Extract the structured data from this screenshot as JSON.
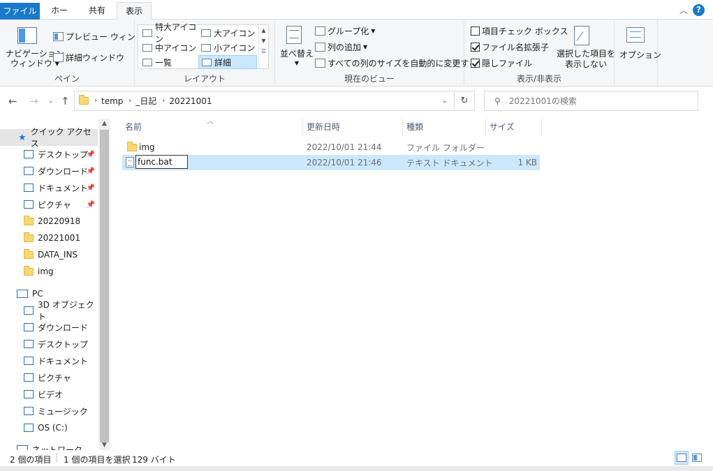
{
  "tabs": {
    "file": "ファイル",
    "home": "ホーム",
    "share": "共有",
    "view": "表示"
  },
  "ribbon": {
    "pane": {
      "nav_pane": "ナビゲーション",
      "nav_pane_2": "ウィンドウ",
      "preview": "プレビュー ウィンドウ",
      "details_pane": "詳細ウィンドウ",
      "label": "ペイン"
    },
    "layout": {
      "items": [
        "特大アイコン",
        "大アイコン",
        "中アイコン",
        "小アイコン",
        "一覧",
        "詳細"
      ],
      "selected": "詳細",
      "label": "レイアウト"
    },
    "current_view": {
      "sort": "並べ替え",
      "group": "グループ化",
      "add_column": "列の追加",
      "autosize": "すべての列のサイズを自動的に変更する",
      "label": "現在のビュー"
    },
    "show_hide": {
      "item_checkbox": "項目チェック ボックス",
      "file_ext": "ファイル名拡張子",
      "hidden": "隠しファイル",
      "hide_selected_1": "選択した項目を",
      "hide_selected_2": "表示しない",
      "label": "表示/非表示",
      "item_checkbox_on": false,
      "file_ext_on": true,
      "hidden_on": true
    },
    "options": "オプション"
  },
  "address": {
    "crumbs": [
      "temp",
      "_日記",
      "20221001"
    ],
    "search_placeholder": "20221001の検索"
  },
  "navpane": {
    "quick": "クイック アクセス",
    "quick_items": [
      {
        "label": "デスクトップ",
        "pinned": true
      },
      {
        "label": "ダウンロード",
        "pinned": true
      },
      {
        "label": "ドキュメント",
        "pinned": true
      },
      {
        "label": "ピクチャ",
        "pinned": true
      },
      {
        "label": "20220918",
        "pinned": false
      },
      {
        "label": "20221001",
        "pinned": false
      },
      {
        "label": "DATA_INS",
        "pinned": false
      },
      {
        "label": "img",
        "pinned": false
      }
    ],
    "pc": "PC",
    "pc_items": [
      "3D オブジェクト",
      "ダウンロード",
      "デスクトップ",
      "ドキュメント",
      "ピクチャ",
      "ビデオ",
      "ミュージック",
      "OS (C:)"
    ],
    "network": "ネットワーク"
  },
  "list": {
    "columns": [
      "名前",
      "更新日時",
      "種類",
      "サイズ"
    ],
    "rows": [
      {
        "name": "img",
        "date": "2022/10/01 21:44",
        "type": "ファイル フォルダー",
        "size": ""
      },
      {
        "name": "func.bat",
        "date": "2022/10/01 21:46",
        "type": "テキスト ドキュメント",
        "size": "1 KB"
      }
    ],
    "rename_value": "func.bat"
  },
  "status": {
    "count": "2 個の項目",
    "selected": "1 個の項目を選択",
    "size": "129 バイト"
  }
}
